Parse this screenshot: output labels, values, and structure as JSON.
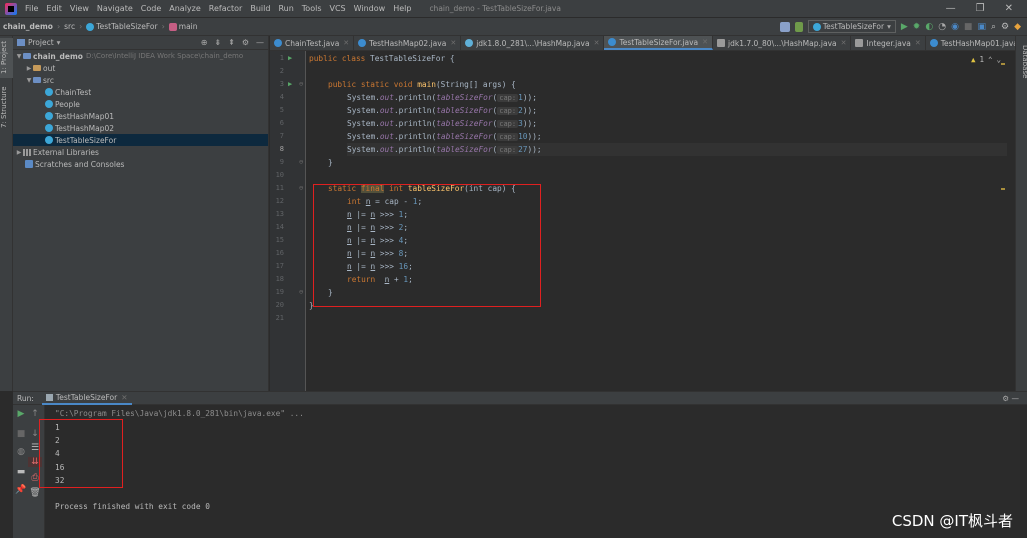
{
  "window": {
    "title": "chain_demo - TestTableSizeFor.java"
  },
  "menu": [
    "File",
    "Edit",
    "View",
    "Navigate",
    "Code",
    "Analyze",
    "Refactor",
    "Build",
    "Run",
    "Tools",
    "VCS",
    "Window",
    "Help"
  ],
  "window_controls": {
    "minimize": "—",
    "restore": "❐",
    "close": "✕"
  },
  "breadcrumb": {
    "project": "chain_demo",
    "folder": "src",
    "class": "TestTableSizeFor",
    "method": "main"
  },
  "toolbar": {
    "run_config": "TestTableSizeFor"
  },
  "side_tabs": {
    "project": "1: Project",
    "structure": "7: Structure",
    "database": "Database"
  },
  "project_panel": {
    "title": "Project",
    "root": {
      "name": "chain_demo",
      "path": "D:\\Core\\IntelliJ IDEA Work Space\\chain_demo"
    },
    "items": [
      {
        "label": "out",
        "kind": "folder"
      },
      {
        "label": "src",
        "kind": "folder"
      },
      {
        "label": "ChainTest",
        "kind": "class"
      },
      {
        "label": "People",
        "kind": "class"
      },
      {
        "label": "TestHashMap01",
        "kind": "class"
      },
      {
        "label": "TestHashMap02",
        "kind": "class"
      },
      {
        "label": "TestTableSizeFor",
        "kind": "class"
      },
      {
        "label": "External Libraries",
        "kind": "lib"
      },
      {
        "label": "Scratches and Consoles",
        "kind": "scratch"
      }
    ]
  },
  "editor_tabs": [
    {
      "label": "ChainTest.java"
    },
    {
      "label": "TestHashMap02.java"
    },
    {
      "label": "jdk1.8.0_281\\...\\HashMap.java"
    },
    {
      "label": "TestTableSizeFor.java"
    },
    {
      "label": "jdk1.7.0_80\\...\\HashMap.java"
    },
    {
      "label": "Integer.java"
    },
    {
      "label": "TestHashMap01.java"
    }
  ],
  "editor": {
    "warnings": "1",
    "line_numbers": [
      "1",
      "2",
      "3",
      "4",
      "5",
      "6",
      "7",
      "8",
      "9",
      "10",
      "11",
      "12",
      "13",
      "14",
      "15",
      "16",
      "17",
      "18",
      "19",
      "20",
      "21"
    ],
    "code": {
      "l1": "public class TestTableSizeFor {",
      "l3a": "public static void ",
      "l3b": "main",
      "l3c": "(String[] args) {",
      "print_prefix": "System.",
      "print_out": "out",
      "print_mid": ".println(",
      "print_fn": "tableSizeFor",
      "print_open": "(",
      "hint": "cap:",
      "args": [
        "1",
        "2",
        "3",
        "10",
        "27"
      ],
      "print_close": "));",
      "close_brace": "}",
      "l11a": "static ",
      "l11b": "final",
      "l11c": " int ",
      "l11d": "tableSizeFor",
      "l11e": "(int cap) {",
      "l12a": "int ",
      "l12b": "n",
      " l12c": " = cap - ",
      "l12d": "1",
      "l12e": ";",
      "shifts": [
        {
          "op": " |= ",
          "var": "n",
          "shift": " >>> ",
          "num": "1"
        },
        {
          "op": " |= ",
          "var": "n",
          "shift": " >>> ",
          "num": "2"
        },
        {
          "op": " |= ",
          "var": "n",
          "shift": " >>> ",
          "num": "4"
        },
        {
          "op": " |= ",
          "var": "n",
          "shift": " >>> ",
          "num": "8"
        },
        {
          "op": " |= ",
          "var": "n",
          "shift": " >>> ",
          "num": "16"
        }
      ],
      "n": "n",
      "semi": ";",
      "ret": "return ",
      "ret_rest": " + ",
      "ret_num": "1"
    }
  },
  "run_panel": {
    "label": "Run:",
    "tab": "TestTableSizeFor"
  },
  "console": {
    "command": "\"C:\\Program Files\\Java\\jdk1.8.0_281\\bin\\java.exe\" ...",
    "outputs": [
      "1",
      "2",
      "4",
      "16",
      "32"
    ],
    "exit": "Process finished with exit code 0"
  },
  "watermark": "CSDN @IT枫斗者"
}
